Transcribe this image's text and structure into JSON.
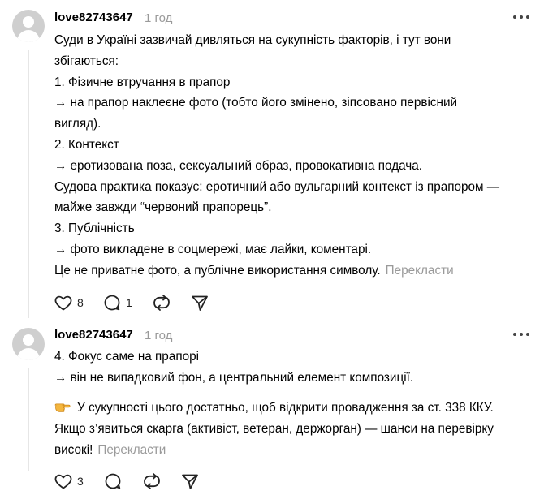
{
  "posts": [
    {
      "author": "love82743647",
      "time": "1 год",
      "lines": [
        "Суди в Україні зазвичай дивляться на сукупність факторів, і тут вони",
        "збігаються:",
        "1. Фізичне втручання в прапор",
        "→ на прапор наклеєне фото (тобто його змінено, зіпсовано первісний",
        "вигляд).",
        "2. Контекст",
        "→ еротизована поза, сексуальний образ, провокативна подача.",
        "Судова практика показує: еротичний або вульгарний контекст із прапором —",
        "майже завжди “червоний прапорець”.",
        "3. Публічність",
        "→ фото викладене в соцмережі, має лайки, коментарі.",
        "Це не приватне фото, а публічне використання символу."
      ],
      "translate": "Перекласти",
      "likes": "8",
      "replies": "1"
    },
    {
      "author": "love82743647",
      "time": "1 год",
      "lines": [
        "4. Фокус саме на прапорі",
        "→ він не випадковий фон, а центральний елемент композиції."
      ],
      "lines2": [
        "У сукупності цього достатньо, щоб відкрити провадження за ст. 338 ККУ.",
        "Якщо з’явиться скарга (активіст, ветеран, держорган) — шанси на перевірку",
        "високі!"
      ],
      "emoji": "pointing-hand-emoji",
      "translate": "Перекласти",
      "likes": "3",
      "replies": ""
    }
  ]
}
